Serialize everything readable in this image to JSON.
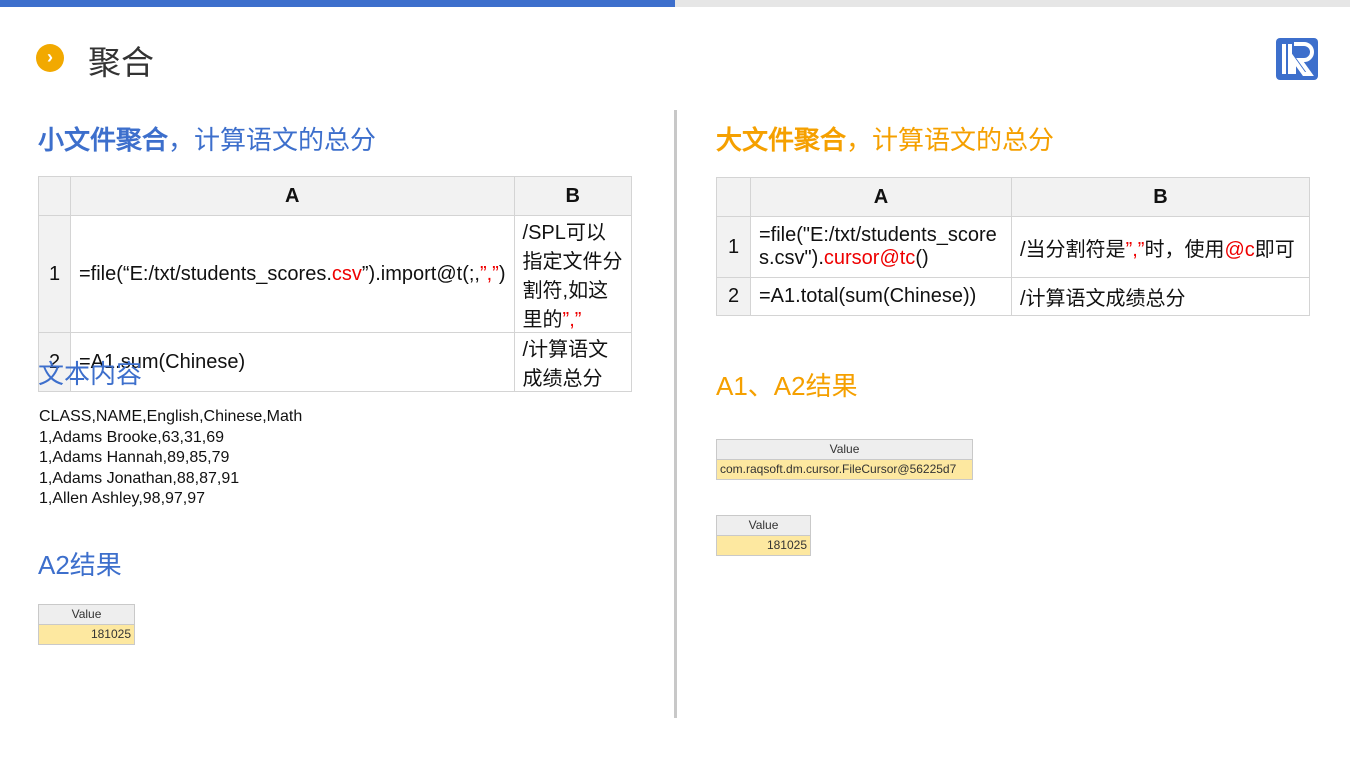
{
  "header": {
    "title": "聚合",
    "bullet_icon": "chevron-right-icon",
    "logo": "R"
  },
  "left": {
    "heading_bold": "小文件聚合",
    "heading_rest": "，计算语文的总分",
    "table": {
      "cols": [
        "A",
        "B"
      ],
      "rows": [
        {
          "num": "1",
          "a": [
            {
              "t": "=file(“E:/txt/students_scores."
            },
            {
              "t": "c",
              "red": true
            },
            {
              "t": "sv",
              "red": true
            },
            {
              "t": "”).import@t(;,"
            },
            {
              "t": "”,”",
              "red": true
            },
            {
              "t": ")"
            }
          ],
          "b": [
            {
              "t": "/SPL可以指定文件分割符,如这里的"
            },
            {
              "t": "”,”",
              "red": true
            }
          ]
        },
        {
          "num": "2",
          "a": [
            {
              "t": "=A1.sum(Chinese)"
            }
          ],
          "b": [
            {
              "t": "/计算语文成绩总分"
            }
          ]
        }
      ]
    },
    "text_heading": "文本内容",
    "text_lines": [
      "CLASS,NAME,English,Chinese,Math",
      "1,Adams Brooke,63,31,69",
      "1,Adams Hannah,89,85,79",
      "1,Adams Jonathan,88,87,91",
      "1,Allen Ashley,98,97,97"
    ],
    "result_heading": "A2结果",
    "result": {
      "header": "Value",
      "value": "181025"
    }
  },
  "right": {
    "heading_bold": "大文件聚合",
    "heading_rest": "，计算语文的总分",
    "table": {
      "cols": [
        "A",
        "B"
      ],
      "rows": [
        {
          "num": "1",
          "a": [
            {
              "t": "=file(\"E:/txt/students_scores.csv\")."
            },
            {
              "t": "cursor@tc",
              "red": true
            },
            {
              "t": "()"
            }
          ],
          "b": [
            {
              "t": "/当分割符是"
            },
            {
              "t": "”,”",
              "red": true
            },
            {
              "t": "时，使用"
            },
            {
              "t": "@c",
              "red": true
            },
            {
              "t": "即可"
            }
          ]
        },
        {
          "num": "2",
          "a": [
            {
              "t": "=A1.total(sum(Chinese))"
            }
          ],
          "b": [
            {
              "t": "/计算语文成绩总分"
            }
          ]
        }
      ]
    },
    "result_heading": "A1、A2结果",
    "result1": {
      "header": "Value",
      "value": "com.raqsoft.dm.cursor.FileCursor@56225d7"
    },
    "result2": {
      "header": "Value",
      "value": "181025"
    }
  },
  "colors": {
    "blue": "#3d6fcc",
    "orange": "#f5a000",
    "red": "#e00000",
    "value_bg": "#fde8a0"
  }
}
